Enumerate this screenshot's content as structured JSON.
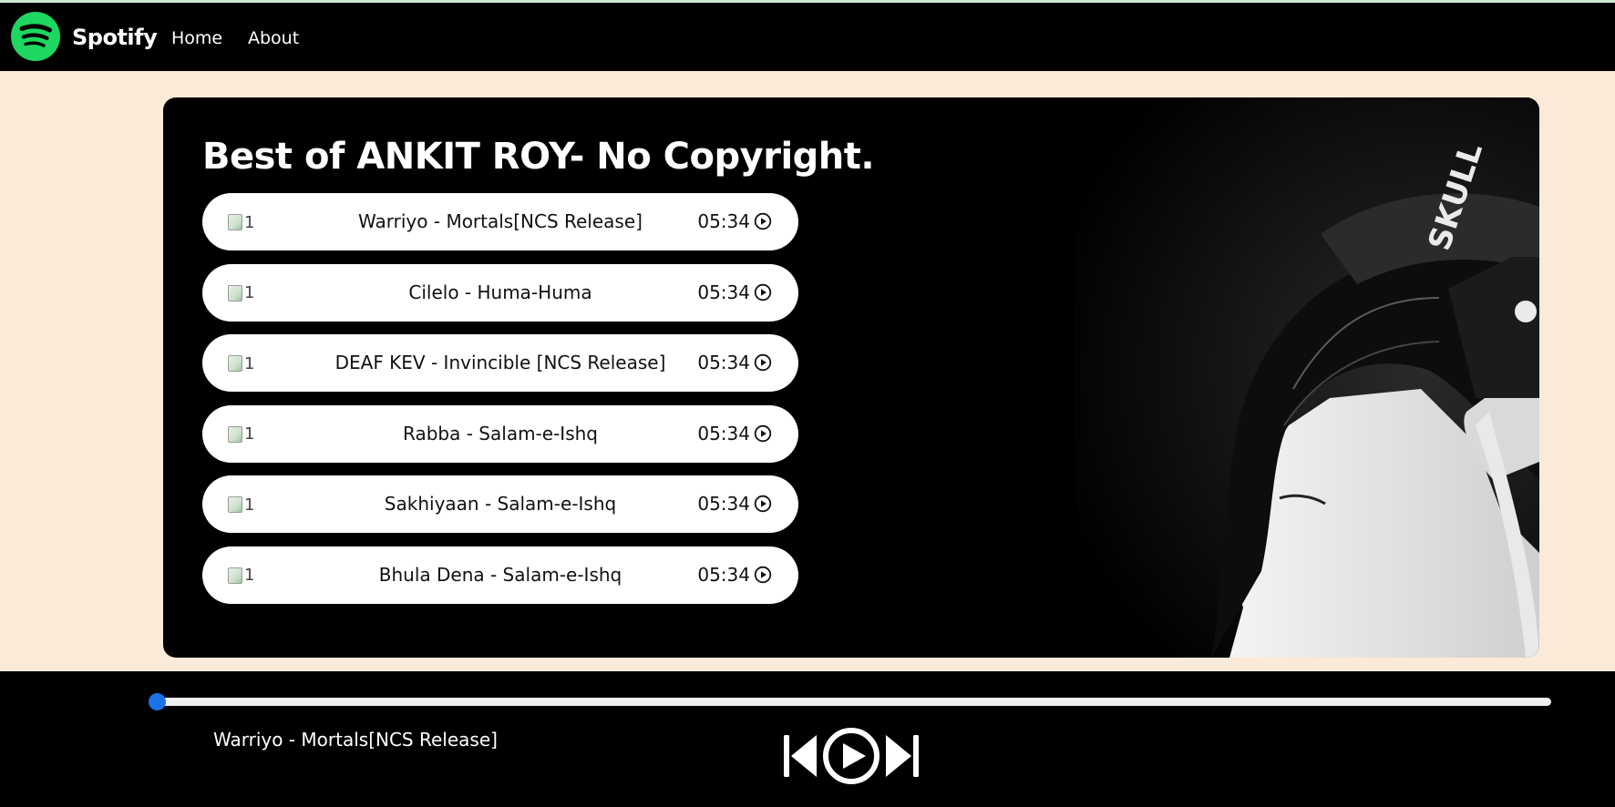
{
  "nav": {
    "brand": "Spotify",
    "links": [
      {
        "label": "Home"
      },
      {
        "label": "About"
      }
    ]
  },
  "playlist": {
    "title": "Best of ANKIT ROY- No Copyright.",
    "songs": [
      {
        "cover_alt": "1",
        "name": "Warriyo - Mortals[NCS Release]",
        "duration": "05:34"
      },
      {
        "cover_alt": "1",
        "name": "Cilelo - Huma-Huma",
        "duration": "05:34"
      },
      {
        "cover_alt": "1",
        "name": "DEAF KEV - Invincible [NCS Release]",
        "duration": "05:34"
      },
      {
        "cover_alt": "1",
        "name": "Rabba - Salam-e-Ishq",
        "duration": "05:34"
      },
      {
        "cover_alt": "1",
        "name": "Sakhiyaan - Salam-e-Ishq",
        "duration": "05:34"
      },
      {
        "cover_alt": "1",
        "name": "Bhula Dena - Salam-e-Ishq",
        "duration": "05:34"
      }
    ]
  },
  "player": {
    "now_playing": "Warriyo - Mortals[NCS Release]",
    "progress": 0,
    "controls": [
      "previous-icon",
      "play-circle-icon",
      "next-icon"
    ]
  },
  "colors": {
    "brand_green": "#1ed760",
    "page_bg": "#fbead7",
    "progress_accent": "#1a73e8"
  }
}
